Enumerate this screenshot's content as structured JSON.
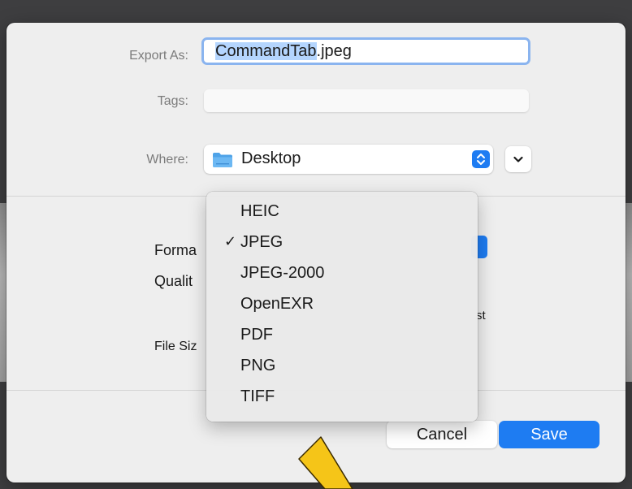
{
  "dialog": {
    "export_as_label": "Export As:",
    "filename_selected": "CommandTab",
    "filename_extension": ".jpeg",
    "tags_label": "Tags:",
    "tags_value": "",
    "where_label": "Where:",
    "where_value": "Desktop",
    "format_label_fragment": "Forma",
    "quality_label_fragment": "Qualit",
    "filesize_label_fragment": "File Siz",
    "best_fragment": "st",
    "cancel_label": "Cancel",
    "save_label": "Save"
  },
  "format_menu": {
    "selected": "JPEG",
    "check_glyph": "✓",
    "items": [
      {
        "label": "HEIC"
      },
      {
        "label": "JPEG"
      },
      {
        "label": "JPEG-2000"
      },
      {
        "label": "OpenEXR"
      },
      {
        "label": "PDF"
      },
      {
        "label": "PNG"
      },
      {
        "label": "TIFF"
      }
    ]
  },
  "colors": {
    "accent": "#1e7cf2",
    "focus_ring": "#8ab4ef",
    "selection": "#b4d5fe",
    "annotation_arrow": "#f5c518"
  },
  "icons": {
    "folder": "folder-icon",
    "where_stepper": "up-down-chevron-icon",
    "expand": "chevron-down-icon",
    "check": "checkmark-icon",
    "annotation": "arrow-icon"
  }
}
